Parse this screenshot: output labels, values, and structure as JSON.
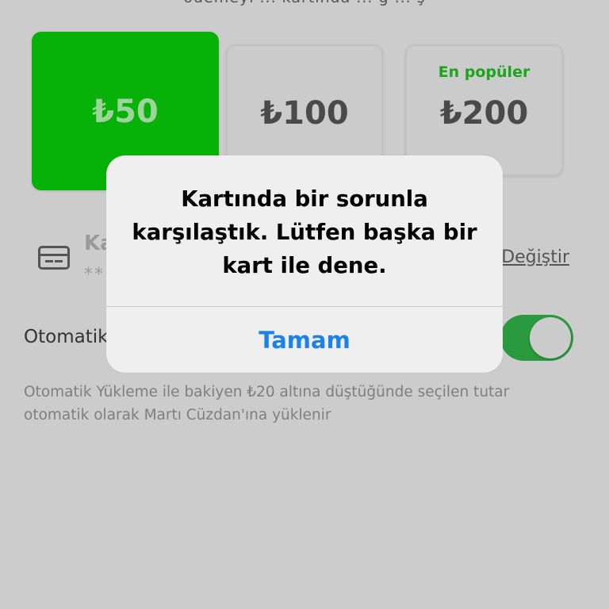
{
  "header": {
    "cutoff_text": "ödemeyi ... kartında ... ğ ... ş"
  },
  "amounts": [
    {
      "label": "₺50",
      "selected": true,
      "tag": ""
    },
    {
      "label": "₺100",
      "selected": false,
      "tag": ""
    },
    {
      "label": "₺200",
      "selected": false,
      "tag": "En popüler"
    }
  ],
  "payment_card": {
    "icon": "credit-card-icon",
    "title": "Ka",
    "number": "**",
    "change_label": "Değiştir"
  },
  "auto_load": {
    "label": "Otomatik",
    "enabled": true,
    "description": "Otomatik Yükleme ile bakiyen ₺20 altına düştüğünde seçilen tutar otomatik olarak Martı Cüzdan'ına yüklenir"
  },
  "alert": {
    "message": "Kartında bir sorunla\nkarşılaştık. Lütfen başka bir\nkart ile dene.",
    "button_label": "Tamam"
  },
  "colors": {
    "accent_green": "#07b107",
    "alert_button_blue": "#1a82ea",
    "toggle_green": "#2a9a3e"
  }
}
